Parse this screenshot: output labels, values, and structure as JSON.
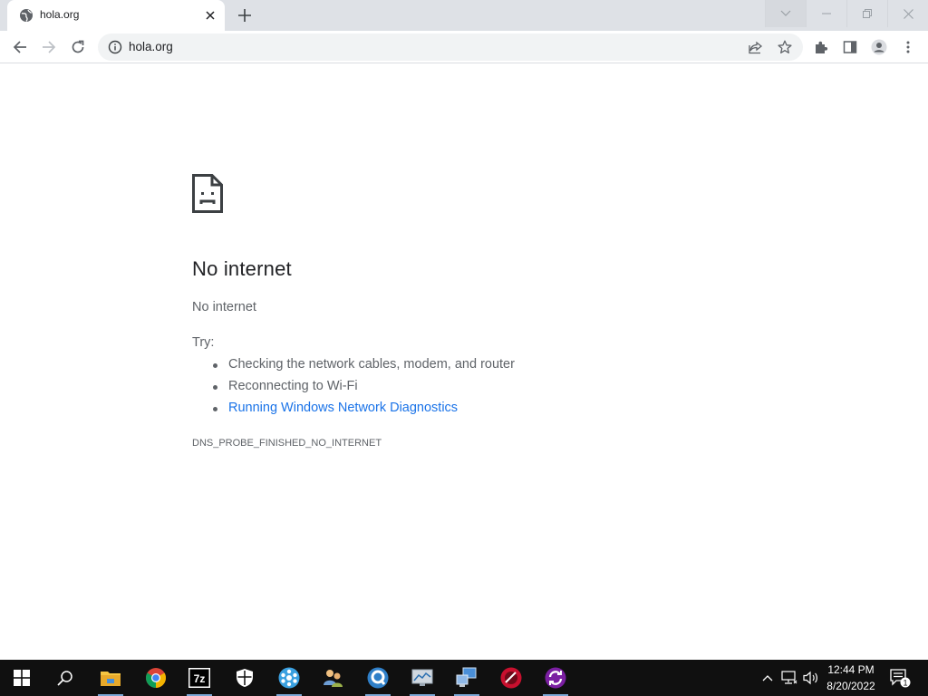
{
  "browser": {
    "tab": {
      "title": "hola.org"
    },
    "address": {
      "url": "hola.org"
    }
  },
  "error_page": {
    "heading": "No internet",
    "summary": "No internet",
    "try_label": "Try:",
    "suggestions": [
      "Checking the network cables, modem, and router",
      "Reconnecting to Wi-Fi",
      "Running Windows Network Diagnostics"
    ],
    "error_code": "DNS_PROBE_FINISHED_NO_INTERNET"
  },
  "taskbar": {
    "apps": [
      "start-icon",
      "search-icon",
      "file-explorer-icon",
      "chrome-icon",
      "7zip-icon",
      "security-shield-icon",
      "network-app-icon",
      "users-app-icon",
      "q-app-icon",
      "monitor-app-icon",
      "remote-desktop-icon",
      "red-disc-app-icon",
      "sync-app-icon"
    ],
    "clock": {
      "time": "12:44 PM",
      "date": "8/20/2022"
    },
    "notification_count": "1"
  },
  "colors": {
    "link": "#1a73e8",
    "text_secondary": "#5f6368",
    "taskbar": "#101010"
  }
}
